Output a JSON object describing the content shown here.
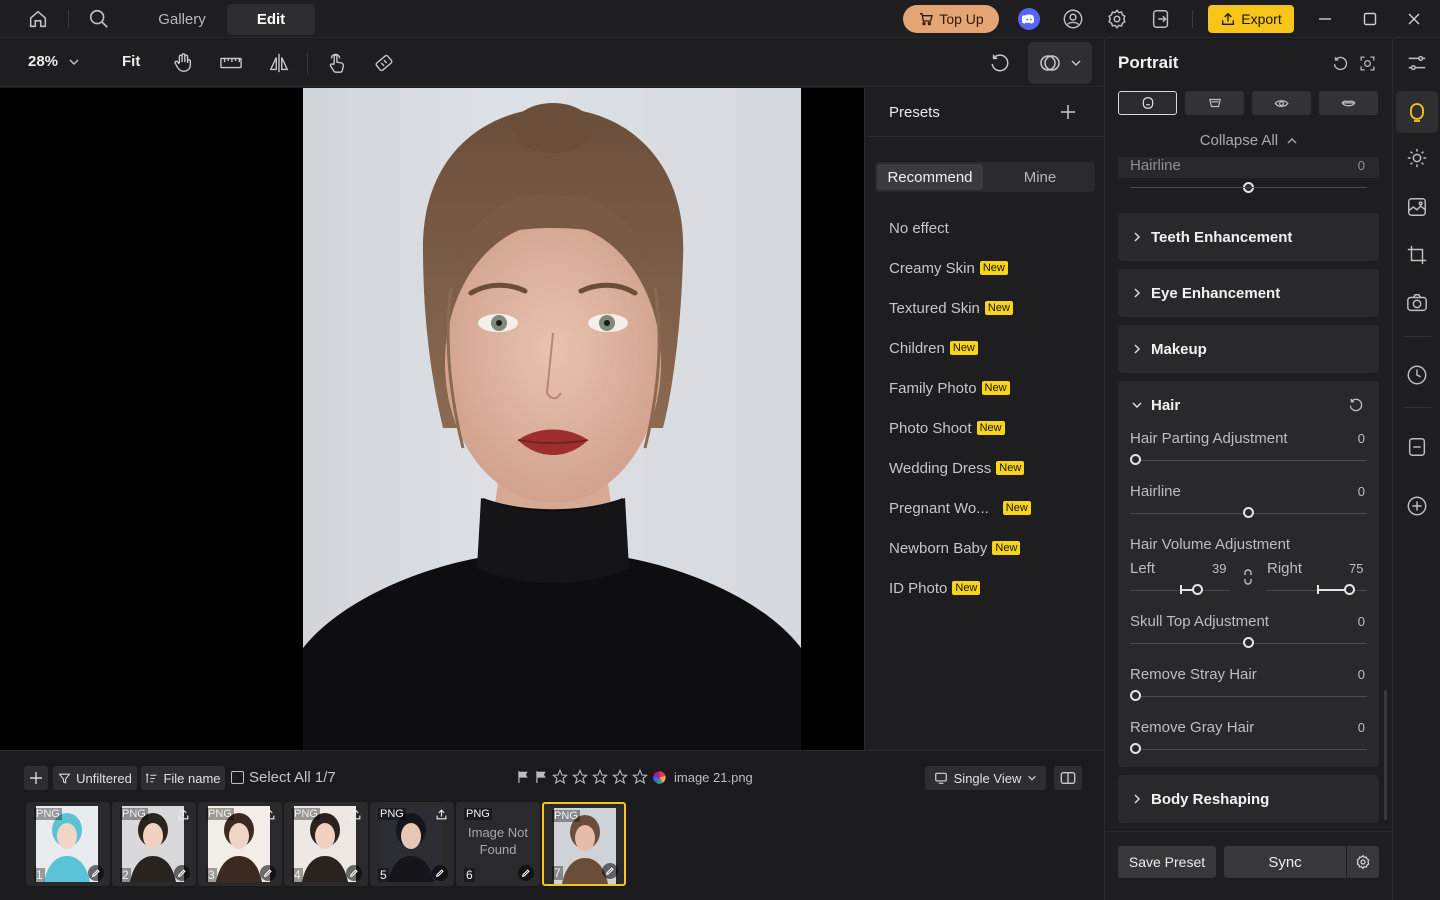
{
  "titlebar": {
    "tabs": [
      "Gallery",
      "Edit"
    ],
    "topup_label": "Top Up",
    "export_label": "Export",
    "icons": [
      "home-icon",
      "search-icon",
      "discord-icon",
      "account-icon",
      "settings-icon",
      "sign-out-icon",
      "minimize-icon",
      "maximize-icon",
      "close-icon"
    ],
    "accent_color": "#f7c51a",
    "topup_color": "#e4a474"
  },
  "toolbar": {
    "zoom": "28%",
    "fit_label": "Fit",
    "icons": [
      "hand-icon",
      "ruler-icon",
      "flip-icon",
      "touch-icon",
      "eraser-icon",
      "undo-icon",
      "compare-icon"
    ]
  },
  "presets": {
    "title": "Presets",
    "tabs": [
      "Recommend",
      "Mine"
    ],
    "badge": "New",
    "items": [
      {
        "label": "No effect",
        "new": false
      },
      {
        "label": "Creamy Skin",
        "new": true
      },
      {
        "label": "Textured Skin",
        "new": true
      },
      {
        "label": "Children",
        "new": true
      },
      {
        "label": "Family Photo",
        "new": true
      },
      {
        "label": "Photo Shoot",
        "new": true
      },
      {
        "label": "Wedding Dress",
        "new": true
      },
      {
        "label": "Pregnant Wo...",
        "new": true
      },
      {
        "label": "Newborn Baby",
        "new": true
      },
      {
        "label": "ID Photo",
        "new": true
      }
    ]
  },
  "portrait": {
    "title": "Portrait",
    "collapse_label": "Collapse All",
    "top_slider": {
      "label": "Hairline",
      "value": "0"
    },
    "sections": {
      "teeth": "Teeth Enhancement",
      "eye": "Eye Enhancement",
      "makeup": "Makeup",
      "hair": "Hair",
      "body": "Body Reshaping"
    },
    "hair": {
      "parting": {
        "label": "Hair Parting Adjustment",
        "value": "0"
      },
      "hairline": {
        "label": "Hairline",
        "value": "0"
      },
      "volume": {
        "label": "Hair Volume Adjustment",
        "left_label": "Left",
        "left_value": "39",
        "right_label": "Right",
        "right_value": "75"
      },
      "skull": {
        "label": "Skull Top Adjustment",
        "value": "0"
      },
      "stray": {
        "label": "Remove Stray Hair",
        "value": "0"
      },
      "gray": {
        "label": "Remove Gray Hair",
        "value": "0"
      }
    },
    "save_preset": "Save Preset",
    "sync": "Sync"
  },
  "filmstrip": {
    "unfiltered": "Unfiltered",
    "file_name": "File name",
    "select_all": "Select All 1/7",
    "filename": "image 21.png",
    "view": "Single View",
    "png": "PNG",
    "not_found": [
      "Image Not",
      "Found"
    ],
    "thumbs": [
      "1",
      "2",
      "3",
      "4",
      "5",
      "6",
      "7"
    ]
  }
}
